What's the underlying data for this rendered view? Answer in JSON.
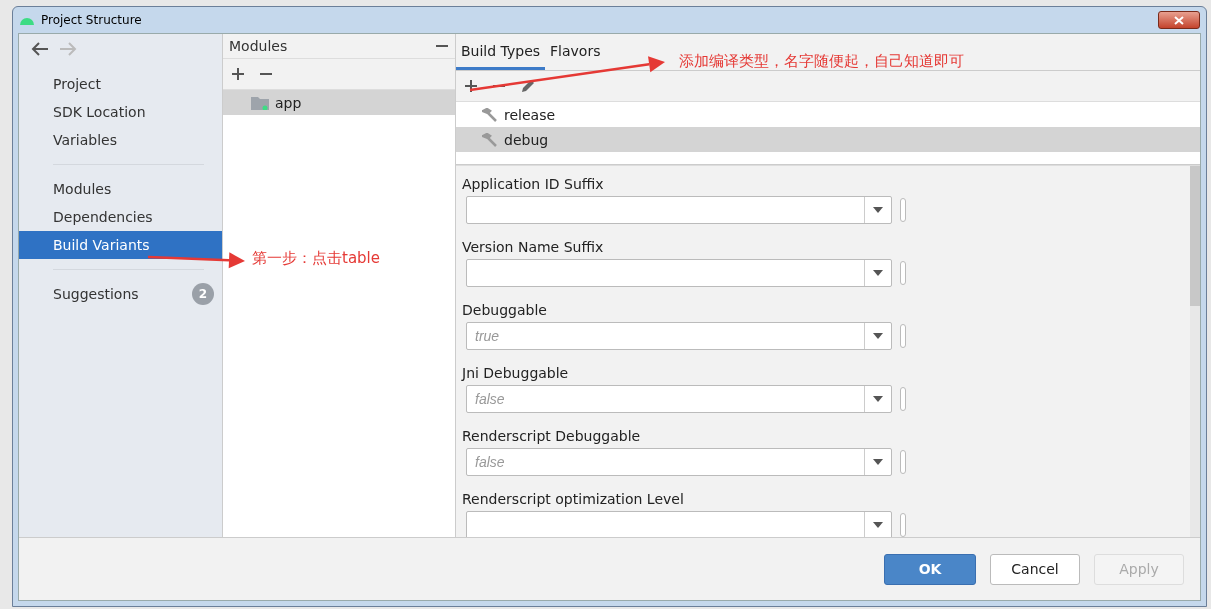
{
  "window": {
    "title": "Project Structure"
  },
  "sidebar": {
    "groups": [
      [
        {
          "label": "Project",
          "selected": false
        },
        {
          "label": "SDK Location",
          "selected": false
        },
        {
          "label": "Variables",
          "selected": false
        }
      ],
      [
        {
          "label": "Modules",
          "selected": false
        },
        {
          "label": "Dependencies",
          "selected": false
        },
        {
          "label": "Build Variants",
          "selected": true
        }
      ],
      [
        {
          "label": "Suggestions",
          "selected": false,
          "badge": "2"
        }
      ]
    ]
  },
  "modules": {
    "title": "Modules",
    "items": [
      {
        "label": "app",
        "selected": true
      }
    ]
  },
  "tabs": [
    {
      "label": "Build Types",
      "selected": true
    },
    {
      "label": "Flavors",
      "selected": false
    }
  ],
  "build_types": [
    {
      "label": "release",
      "selected": false
    },
    {
      "label": "debug",
      "selected": true
    }
  ],
  "fields": [
    {
      "label": "Application ID Suffix"
    },
    {
      "label": "Version Name Suffix"
    },
    {
      "label": "Debuggable",
      "placeholder": "true"
    },
    {
      "label": "Jni Debuggable",
      "placeholder": "false"
    },
    {
      "label": "Renderscript Debuggable",
      "placeholder": "false"
    },
    {
      "label": "Renderscript optimization Level"
    }
  ],
  "buttons": [
    {
      "label": "OK",
      "kind": "primary",
      "disabled": false
    },
    {
      "label": "Cancel",
      "kind": "normal",
      "disabled": false
    },
    {
      "label": "Apply",
      "kind": "normal",
      "disabled": true
    }
  ],
  "annotations": [
    {
      "text": "第一步：点击table"
    },
    {
      "text": "添加编译类型，名字随便起，自己知道即可"
    }
  ]
}
